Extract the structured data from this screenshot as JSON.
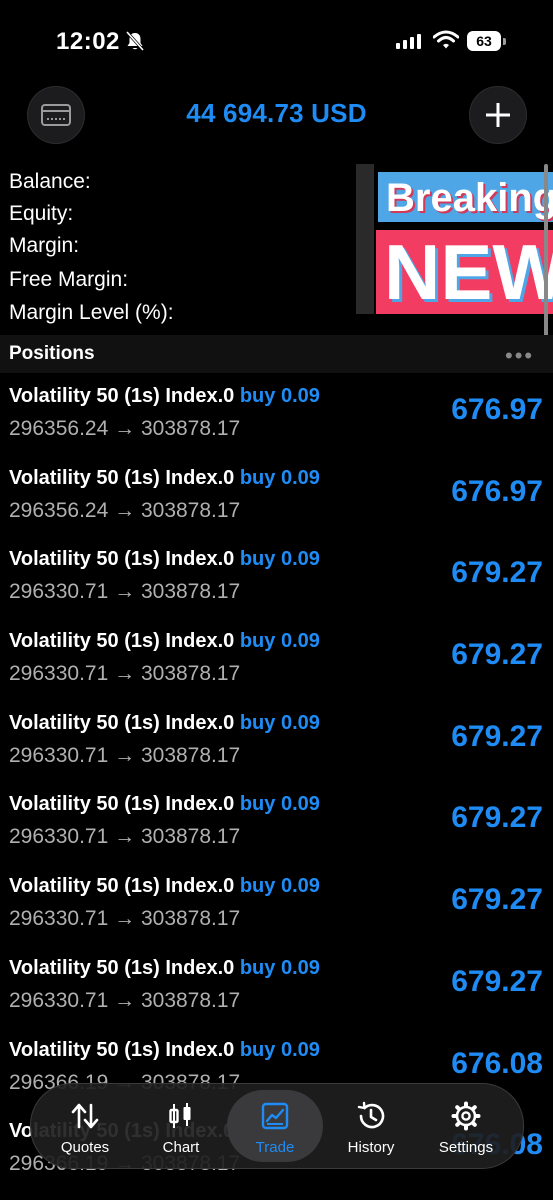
{
  "status_bar": {
    "time": "12:02",
    "battery": "63"
  },
  "header": {
    "balance_title": "44 694.73 USD"
  },
  "account_summary": {
    "labels": [
      "Balance:",
      "Equity:",
      "Margin:",
      "Free Margin:",
      "Margin Level (%):"
    ]
  },
  "overlay": {
    "line1": "Breaking",
    "line2": "NEW"
  },
  "positions": {
    "title": "Positions",
    "items": [
      {
        "symbol": "Volatility 50 (1s) Index.0",
        "side": "buy 0.09",
        "open_price": "296356.24",
        "arrow": "→",
        "current_price": "303878.17",
        "profit": "676.97"
      },
      {
        "symbol": "Volatility 50 (1s) Index.0",
        "side": "buy 0.09",
        "open_price": "296356.24",
        "arrow": "→",
        "current_price": "303878.17",
        "profit": "676.97"
      },
      {
        "symbol": "Volatility 50 (1s) Index.0",
        "side": "buy 0.09",
        "open_price": "296330.71",
        "arrow": "→",
        "current_price": "303878.17",
        "profit": "679.27"
      },
      {
        "symbol": "Volatility 50 (1s) Index.0",
        "side": "buy 0.09",
        "open_price": "296330.71",
        "arrow": "→",
        "current_price": "303878.17",
        "profit": "679.27"
      },
      {
        "symbol": "Volatility 50 (1s) Index.0",
        "side": "buy 0.09",
        "open_price": "296330.71",
        "arrow": "→",
        "current_price": "303878.17",
        "profit": "679.27"
      },
      {
        "symbol": "Volatility 50 (1s) Index.0",
        "side": "buy 0.09",
        "open_price": "296330.71",
        "arrow": "→",
        "current_price": "303878.17",
        "profit": "679.27"
      },
      {
        "symbol": "Volatility 50 (1s) Index.0",
        "side": "buy 0.09",
        "open_price": "296330.71",
        "arrow": "→",
        "current_price": "303878.17",
        "profit": "679.27"
      },
      {
        "symbol": "Volatility 50 (1s) Index.0",
        "side": "buy 0.09",
        "open_price": "296330.71",
        "arrow": "→",
        "current_price": "303878.17",
        "profit": "679.27"
      },
      {
        "symbol": "Volatility 50 (1s) Index.0",
        "side": "buy 0.09",
        "open_price": "296366.19",
        "arrow": "→",
        "current_price": "303878.17",
        "profit": "676.08"
      },
      {
        "symbol": "Volatility 50 (1s) Index.0",
        "side": "buy 0.09",
        "open_price": "296366.19",
        "arrow": "→",
        "current_price": "303878.17",
        "profit": "676.08"
      }
    ]
  },
  "nav": {
    "items": [
      "Quotes",
      "Chart",
      "Trade",
      "History",
      "Settings"
    ],
    "active": "Trade"
  },
  "colors": {
    "accent": "#1f8cf5",
    "background": "#000000",
    "muted_text": "#b0b0b0"
  }
}
